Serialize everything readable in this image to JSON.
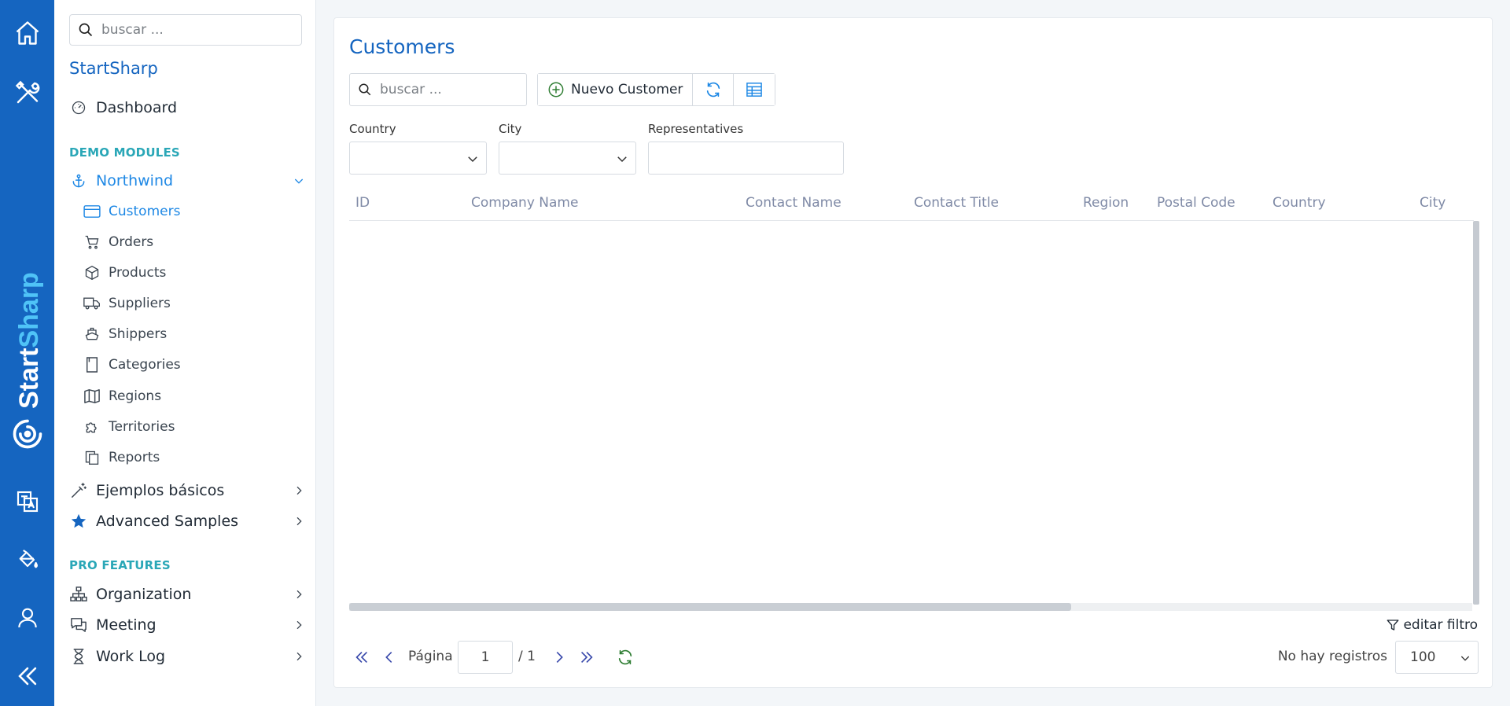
{
  "rail": {
    "brand_start": "Start",
    "brand_sharp": "Sharp",
    "colors": {
      "bg": "#1565c0",
      "brand_accent": "#4fc3f7"
    }
  },
  "sidebar": {
    "search_placeholder": "buscar ...",
    "app_title": "StartSharp",
    "dashboard": "Dashboard",
    "section_demo": "DEMO MODULES",
    "northwind": "Northwind",
    "northwind_items": [
      {
        "label": "Customers",
        "icon": "card-icon"
      },
      {
        "label": "Orders",
        "icon": "cart-icon"
      },
      {
        "label": "Products",
        "icon": "box-icon"
      },
      {
        "label": "Suppliers",
        "icon": "truck-icon"
      },
      {
        "label": "Shippers",
        "icon": "ship-icon"
      },
      {
        "label": "Categories",
        "icon": "bookmark-icon"
      },
      {
        "label": "Regions",
        "icon": "map-icon"
      },
      {
        "label": "Territories",
        "icon": "puzzle-icon"
      },
      {
        "label": "Reports",
        "icon": "copy-icon"
      }
    ],
    "basic_samples": "Ejemplos básicos",
    "advanced_samples": "Advanced Samples",
    "section_pro": "PRO FEATURES",
    "organization": "Organization",
    "meeting": "Meeting",
    "work_log": "Work Log"
  },
  "main": {
    "title": "Customers",
    "search_placeholder": "buscar ...",
    "new_button": "Nuevo Customer",
    "filters": {
      "country_label": "Country",
      "city_label": "City",
      "representatives_label": "Representatives"
    },
    "columns": [
      "ID",
      "Company Name",
      "Contact Name",
      "Contact Title",
      "Region",
      "Postal Code",
      "Country",
      "City"
    ],
    "edit_filter": "editar filtro",
    "pager": {
      "page_label": "Página",
      "page_value": "1",
      "total": "/ 1",
      "no_records": "No hay registros",
      "page_size": "100"
    }
  }
}
